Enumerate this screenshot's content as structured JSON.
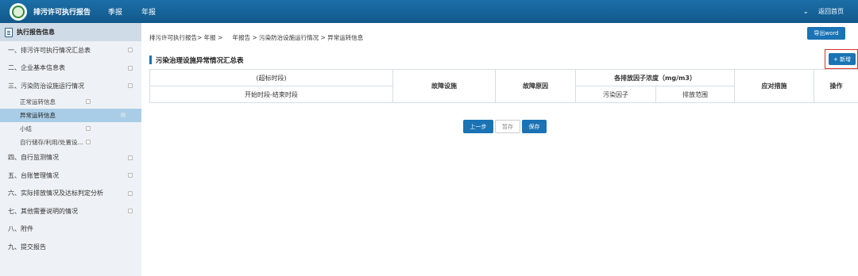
{
  "header": {
    "app_title": "排污许可执行报告",
    "nav": [
      "季报",
      "年报"
    ],
    "home_link": "返回首页"
  },
  "sidebar": {
    "title": "执行报告信息",
    "items": [
      {
        "label": "一、排污许可执行情况汇总表"
      },
      {
        "label": "二、企业基本信息表"
      },
      {
        "label": "三、污染防治设施运行情况"
      },
      {
        "label": "正常运转信息"
      },
      {
        "label": "异常运转信息"
      },
      {
        "label": "小结"
      },
      {
        "label": "自行储存/利用/处置设..."
      },
      {
        "label": "四、自行监测情况"
      },
      {
        "label": "五、台账管理情况"
      },
      {
        "label": "六、实际排放情况及达标判定分析"
      },
      {
        "label": "七、其他需要说明的情况"
      },
      {
        "label": "八、附件"
      },
      {
        "label": "九、提交报告"
      }
    ]
  },
  "main": {
    "breadcrumb": "排污许可执行报告> 年报 > 　 年报告 > 污染防治设施运行情况 > 异常运转信息",
    "export_label": "导出word",
    "section_title": "污染治理设施异常情况汇总表",
    "add_label": "+ 新增",
    "table": {
      "period_header": "(超标时段)",
      "period_sub": "开始时段-结束时段",
      "facility": "故障设施",
      "cause": "故障原因",
      "concentration": "各排放因子浓度（mg/m3）",
      "factor": "污染因子",
      "range": "排放范围",
      "measures": "应对措施",
      "operation": "操作"
    },
    "buttons": {
      "prev": "上一步",
      "draft": "暂存",
      "save": "保存"
    }
  },
  "colors": {
    "topbar": "#1b6fa8",
    "accent": "#1a73b4",
    "sidebar_bg": "#eef2f6",
    "active_item": "#a9cde6",
    "highlight_border": "#d9302c"
  },
  "icons": {
    "logo": "environment-seal-logo",
    "sidebar_header": "document-icon",
    "home_chevron": "chevron-down-icon"
  }
}
